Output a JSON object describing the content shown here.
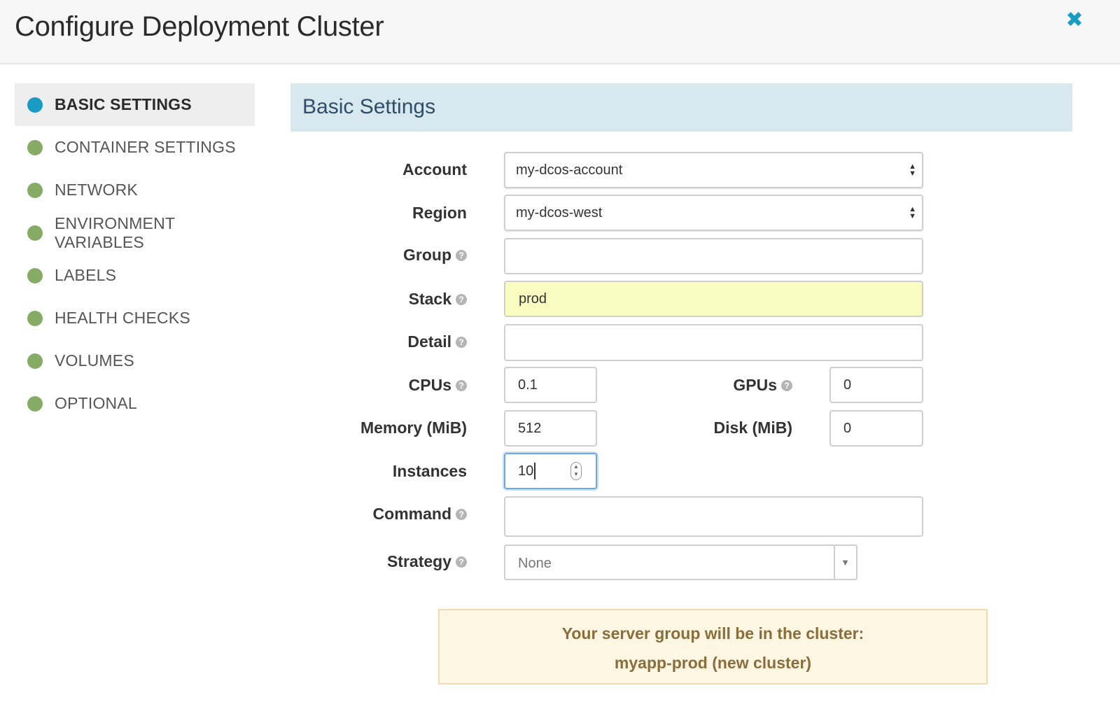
{
  "dialog": {
    "title": "Configure Deployment Cluster",
    "close_icon": "close-icon"
  },
  "sidebar": {
    "items": [
      {
        "label": "BASIC SETTINGS",
        "active": true
      },
      {
        "label": "CONTAINER SETTINGS",
        "active": false
      },
      {
        "label": "NETWORK",
        "active": false
      },
      {
        "label": "ENVIRONMENT VARIABLES",
        "active": false
      },
      {
        "label": "LABELS",
        "active": false
      },
      {
        "label": "HEALTH CHECKS",
        "active": false
      },
      {
        "label": "VOLUMES",
        "active": false
      },
      {
        "label": "OPTIONAL",
        "active": false
      }
    ]
  },
  "section": {
    "title": "Basic Settings"
  },
  "form": {
    "account": {
      "label": "Account",
      "value": "my-dcos-account"
    },
    "region": {
      "label": "Region",
      "value": "my-dcos-west"
    },
    "group": {
      "label": "Group",
      "value": ""
    },
    "stack": {
      "label": "Stack",
      "value": "prod"
    },
    "detail": {
      "label": "Detail",
      "value": ""
    },
    "cpus": {
      "label": "CPUs",
      "value": "0.1"
    },
    "gpus": {
      "label": "GPUs",
      "value": "0"
    },
    "memory": {
      "label": "Memory (MiB)",
      "value": "512"
    },
    "disk": {
      "label": "Disk (MiB)",
      "value": "0"
    },
    "instances": {
      "label": "Instances",
      "value": "10"
    },
    "command": {
      "label": "Command",
      "value": ""
    },
    "strategy": {
      "label": "Strategy",
      "value": "None"
    }
  },
  "notice": {
    "line1": "Your server group will be in the cluster:",
    "line2": "myapp-prod (new cluster)"
  },
  "colors": {
    "accent": "#1a9bc4",
    "nav_dot": "#86ab64",
    "section_bg": "#d7e8ee",
    "highlight": "#fafdc0",
    "notice_bg": "#fcf6e2"
  }
}
